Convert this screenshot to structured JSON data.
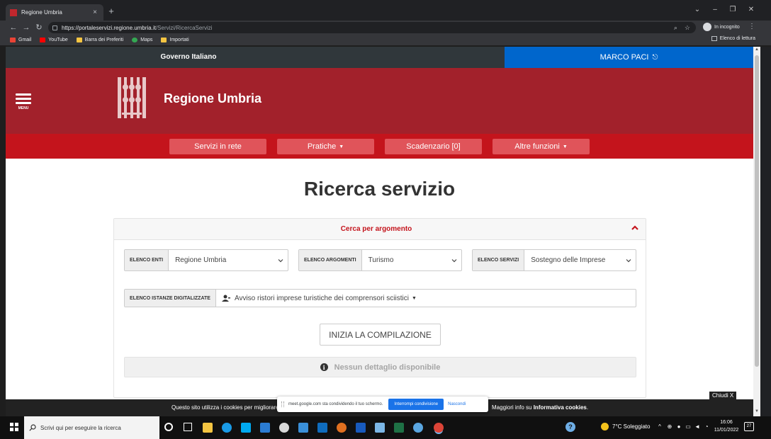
{
  "browser": {
    "tab_title": "Regione Umbria",
    "tab_close": "×",
    "new_tab": "+",
    "url_main": "https://portaleservizi.regione.umbria.it",
    "url_path": "/Servizi/RicercaServizi",
    "incognito_label": "In incognito",
    "bookmarks": [
      {
        "label": "Gmail",
        "color": "#ea4335"
      },
      {
        "label": "YouTube",
        "color": "#ff0000"
      },
      {
        "label": "Barra dei Preferiti",
        "color": "#f5c542"
      },
      {
        "label": "Maps",
        "color": "#34a853"
      },
      {
        "label": "Importati",
        "color": "#f5c542"
      }
    ],
    "reading_list": "Elenco di lettura"
  },
  "gov_bar": {
    "label": "Governo Italiano",
    "user_name": "MARCO PACI"
  },
  "header": {
    "menu_label": "MENU",
    "site_title": "Regione Umbria"
  },
  "nav": {
    "items": [
      "Servizi in rete",
      "Pratiche",
      "Scadenzario [0]",
      "Altre funzioni"
    ]
  },
  "main": {
    "page_title": "Ricerca servizio",
    "panel_title": "Cerca per argomento",
    "fields": [
      {
        "label": "ELENCO ENTI",
        "value": "Regione Umbria"
      },
      {
        "label": "ELENCO ARGOMENTI",
        "value": "Turismo"
      },
      {
        "label": "ELENCO SERVIZI",
        "value": "Sostegno delle Imprese"
      }
    ],
    "istanze_label": "ELENCO ISTANZE DIGITALIZZATE",
    "istanze_value": "Avviso ristori imprese turistiche dei comprensori sciistici",
    "start_button": "INIZIA LA COMPILAZIONE",
    "no_detail": "Nessun dettaglio disponibile"
  },
  "cookie": {
    "left_text": "Questo sito utilizza i cookies per migliorare",
    "right_prefix": "Maggiori info su ",
    "right_link": "Informativa cookies",
    "right_suffix": ".",
    "close": "Chiudi X"
  },
  "share_popup": {
    "text": "meet.google.com sta condividendo il tuo schermo.",
    "stop": "Interrompi condivisione",
    "hide": "Nascondi"
  },
  "taskbar": {
    "search_placeholder": "Scrivi qui per eseguire la ricerca",
    "weather": "7°C Soleggiato",
    "time": "16:06",
    "date": "11/01/2022",
    "notifications": "27"
  },
  "colors": {
    "header_red": "#a2212b",
    "nav_red": "#c4141c",
    "nav_button": "#e0545a",
    "user_blue": "#0066cc",
    "gov_dark": "#30373b"
  }
}
